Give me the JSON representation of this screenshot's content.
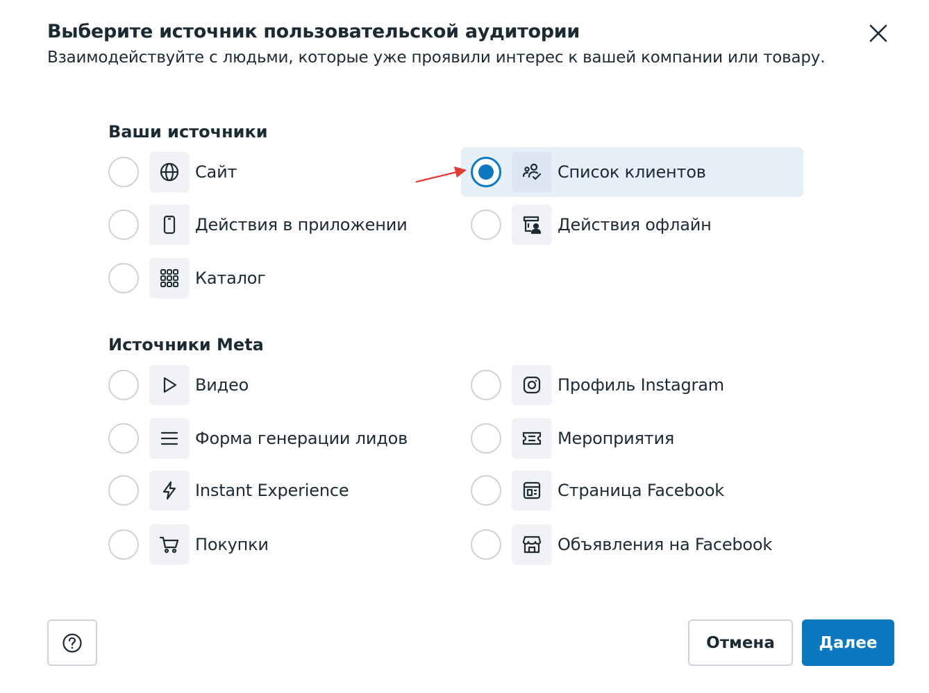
{
  "dialog": {
    "title": "Выберите источник пользовательской аудитории",
    "subtitle": "Взаимодействуйте с людьми, которые уже проявили интерес к вашей компании или товару."
  },
  "sections": {
    "your_sources": {
      "title": "Ваши источники",
      "options": [
        {
          "label": "Сайт",
          "icon": "globe-icon",
          "selected": false
        },
        {
          "label": "Список клиентов",
          "icon": "customer-list-icon",
          "selected": true
        },
        {
          "label": "Действия в приложении",
          "icon": "mobile-icon",
          "selected": false
        },
        {
          "label": "Действия офлайн",
          "icon": "offline-store-icon",
          "selected": false
        },
        {
          "label": "Каталог",
          "icon": "grid-icon",
          "selected": false
        }
      ]
    },
    "meta_sources": {
      "title": "Источники Meta",
      "options": [
        {
          "label": "Видео",
          "icon": "play-icon",
          "selected": false
        },
        {
          "label": "Профиль Instagram",
          "icon": "instagram-icon",
          "selected": false
        },
        {
          "label": "Форма генерации лидов",
          "icon": "menu-lines-icon",
          "selected": false
        },
        {
          "label": "Мероприятия",
          "icon": "ticket-icon",
          "selected": false
        },
        {
          "label": "Instant Experience",
          "icon": "lightning-icon",
          "selected": false
        },
        {
          "label": "Страница Facebook",
          "icon": "page-icon",
          "selected": false
        },
        {
          "label": "Покупки",
          "icon": "cart-icon",
          "selected": false
        },
        {
          "label": "Объявления на Facebook",
          "icon": "storefront-icon",
          "selected": false
        }
      ]
    }
  },
  "footer": {
    "cancel_label": "Отмена",
    "next_label": "Далее"
  },
  "colors": {
    "accent": "#0a78be",
    "selected_bg": "#e6eef8",
    "annotation_arrow": "#e53935"
  }
}
